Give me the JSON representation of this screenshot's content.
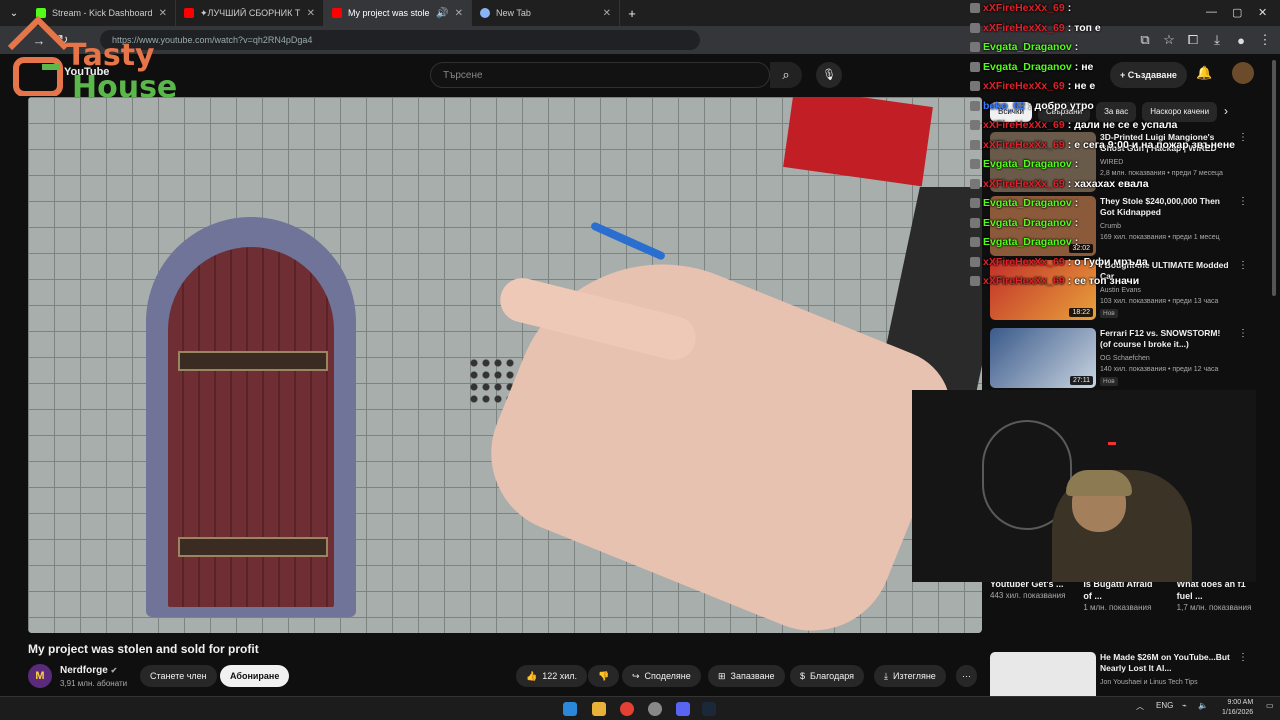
{
  "browser": {
    "tabs": [
      {
        "title": "Stream - Kick Dashboard",
        "color": "#53fc18"
      },
      {
        "title": "✦ЛУЧШИЙ СБОРНИК ТРЕКОВ",
        "color": "#ff0000"
      },
      {
        "title": "My project was stolen and",
        "color": "#ff0000"
      },
      {
        "title": "New Tab",
        "color": "#8ab4f8"
      }
    ],
    "url": "https://www.youtube.com/watch?v=qh2RN4pDga4"
  },
  "youtube": {
    "logo": "YouTube",
    "search_placeholder": "Търсене",
    "create_label": "Създаване",
    "video_title": "My project was stolen and sold for profit",
    "channel": {
      "name": "Nerdforge",
      "subs": "3,91 млн. абонати",
      "avatar_letter": "M"
    },
    "join_label": "Станете член",
    "subscribe_label": "Абониране",
    "likes": "122 хил.",
    "share_label": "Споделяне",
    "save_label": "Запазване",
    "thanks_label": "Благодаря",
    "download_label": "Изтегляне"
  },
  "overlay_logo": {
    "line1": "Tasty",
    "line2": "House"
  },
  "sidebar": {
    "chips": [
      "Всички",
      "Свързани",
      "За вас",
      "Наскоро качени"
    ],
    "videos": [
      {
        "title": "3D-Printed Luigi Mangione's Ghost Gun | Hackaр | WIRED",
        "channel": "WIRED",
        "meta": "2,8 млн. показвания • преди 7 месеца",
        "duration": "",
        "badge": "",
        "thumb": "#6a5a4a"
      },
      {
        "title": "They Stole $240,000,000 Then Got Kidnapped",
        "channel": "Crumb",
        "meta": "169 хил. показвания • преди 1 месец",
        "duration": "32:02",
        "badge": "",
        "thumb": "#8a5a3a"
      },
      {
        "title": "I Bought the ULTIMATE Modded Car",
        "channel": "Austin Evans",
        "meta": "103 хил. показвания • преди 13 часа",
        "duration": "18:22",
        "badge": "Нов",
        "thumb": "#c2302a"
      },
      {
        "title": "Ferrari F12 vs. SNOWSTORM! (of course I broke it...)",
        "channel": "OG Schaefchen",
        "meta": "140 хил. показвания • преди 12 часа",
        "duration": "27:11",
        "badge": "Нов",
        "thumb": "#3a5a8a"
      },
      {
        "title": "He Made $26M on YouTube...But Nearly Lost It Al...",
        "channel": "Jon Youshaei и Linus Tech Tips",
        "meta": "",
        "duration": "",
        "badge": "",
        "thumb": "#e8e8e8"
      }
    ],
    "shorts": [
      {
        "title": "Youtuber Get's ...",
        "views": "443 хил. показвания"
      },
      {
        "title": "Is Bugatti Afraid of ...",
        "views": "1 млн. показвания"
      },
      {
        "title": "What does an f1 fuel ...",
        "views": "1,7 млн. показвания"
      }
    ]
  },
  "chat": [
    {
      "user": "xXFireHexXx_69",
      "msg": "",
      "color": "#e0202a"
    },
    {
      "user": "xXFireHexXx_69",
      "msg": "топ е",
      "color": "#e0202a"
    },
    {
      "user": "Evgata_Draganov",
      "msg": "",
      "color": "#53fc18"
    },
    {
      "user": "Evgata_Draganov",
      "msg": "не",
      "color": "#53fc18"
    },
    {
      "user": "xXFireHexXx_69",
      "msg": "не е",
      "color": "#e0202a"
    },
    {
      "user": "beko_02",
      "msg": "добро утро",
      "color": "#3a7bff"
    },
    {
      "user": "xXFireHexXx_69",
      "msg": "дали не се е успала",
      "color": "#e0202a"
    },
    {
      "user": "xXFireHexXx_69",
      "msg": "е сега 9:00 и на пожар звънене",
      "color": "#e0202a"
    },
    {
      "user": "Evgata_Draganov",
      "msg": "",
      "color": "#53fc18"
    },
    {
      "user": "xXFireHexXx_69",
      "msg": "хахахах евала",
      "color": "#e0202a"
    },
    {
      "user": "Evgata_Draganov",
      "msg": "",
      "color": "#53fc18"
    },
    {
      "user": "Evgata_Draganov",
      "msg": "",
      "color": "#53fc18"
    },
    {
      "user": "Evgata_Draganov",
      "msg": "",
      "color": "#53fc18"
    },
    {
      "user": "xXFireHexXx_69",
      "msg": "о Гуфи мръда",
      "color": "#e0202a"
    },
    {
      "user": "xXFireHexXx_69",
      "msg": "ее топ значи",
      "color": "#e0202a"
    }
  ],
  "taskbar": {
    "lang": "ENG",
    "time": "9:00 AM",
    "date": "1/16/2026"
  }
}
